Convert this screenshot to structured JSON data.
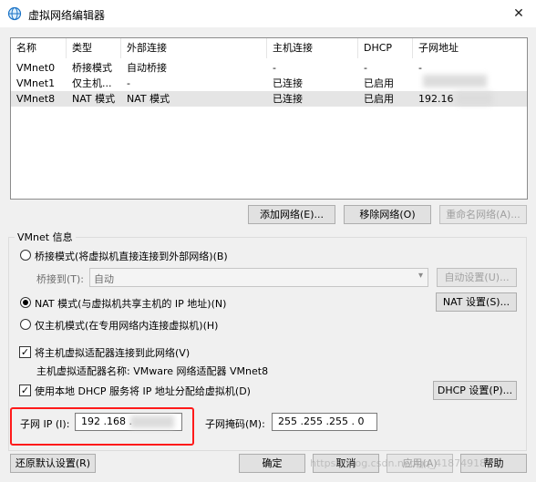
{
  "window": {
    "title": "虚拟网络编辑器",
    "close_glyph": "✕"
  },
  "table": {
    "headers": [
      "名称",
      "类型",
      "外部连接",
      "主机连接",
      "DHCP",
      "子网地址"
    ],
    "rows": [
      [
        "VMnet0",
        "桥接模式",
        "自动桥接",
        "-",
        "-",
        "-"
      ],
      [
        "VMnet1",
        "仅主机...",
        "-",
        "已连接",
        "已启用",
        ""
      ],
      [
        "VMnet8",
        "NAT 模式",
        "NAT 模式",
        "已连接",
        "已启用",
        "192.16"
      ]
    ]
  },
  "buttons": {
    "add_network": "添加网络(E)...",
    "remove_network": "移除网络(O)",
    "rename_network": "重命名网络(A)...",
    "auto_settings": "自动设置(U)...",
    "nat_settings": "NAT 设置(S)...",
    "dhcp_settings": "DHCP 设置(P)...",
    "restore_defaults": "还原默认设置(R)",
    "ok": "确定",
    "cancel": "取消",
    "apply": "应用(A)",
    "help": "帮助"
  },
  "vmnet_info": {
    "label": "VMnet 信息",
    "bridged_mode": "桥接模式(将虚拟机直接连接到外部网络)(B)",
    "bridged_to_label": "桥接到(T):",
    "bridged_to_value": "自动",
    "nat_mode": "NAT 模式(与虚拟机共享主机的 IP 地址)(N)",
    "host_only_mode": "仅主机模式(在专用网络内连接虚拟机)(H)",
    "connect_adapter": "将主机虚拟适配器连接到此网络(V)",
    "adapter_name": "主机虚拟适配器名称: VMware 网络适配器 VMnet8",
    "use_dhcp": "使用本地 DHCP 服务将 IP 地址分配给虚拟机(D)",
    "subnet_ip_label": "子网 IP (I):",
    "subnet_ip_value": "192 .168 .",
    "subnet_mask_label": "子网掩码(M):",
    "subnet_mask_value": "255 .255 .255 . 0"
  },
  "watermark": "https://blog.csdn.net/qq_41874918"
}
